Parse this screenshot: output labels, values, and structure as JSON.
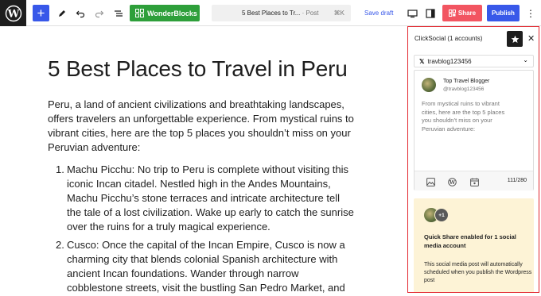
{
  "toolbar": {
    "wonderblocks_label": "WonderBlocks",
    "doc_title": "5 Best Places to Tr...",
    "doc_type": "· Post",
    "shortcut": "⌘K",
    "save_draft_label": "Save draft",
    "share_label": "Share",
    "publish_label": "Publish"
  },
  "post": {
    "title": "5 Best Places to Travel in Peru",
    "intro": "Peru, a land of ancient civilizations and breathtaking landscapes, offers travelers an unforgettable experience. From mystical ruins to vibrant cities, here are the top 5 places you shouldn’t miss on your Peruvian adventure:",
    "list": [
      {
        "num": "1.",
        "text": "Machu Picchu: No trip to Peru is complete without visiting this iconic Incan citadel. Nestled high in the Andes Mountains, Machu Picchu’s stone terraces and intricate architecture tell the tale of a lost civilization. Wake up early to catch the sunrise over the ruins for a truly magical experience."
      },
      {
        "num": "2.",
        "text": "Cusco: Once the capital of the Incan Empire, Cusco is now a charming city that blends colonial Spanish architecture with ancient Incan foundations. Wander through narrow cobblestone streets, visit the bustling San Pedro Market, and"
      }
    ]
  },
  "sidebar": {
    "title": "ClickSocial (1 accounts)",
    "account": "travblog123456",
    "user_name": "Top Travel Blogger",
    "user_handle": "@travblog123456",
    "post_text": "From mystical ruins to vibrant cities, here are the top 5 places you shouldn’t miss on your Peruvian adventure:",
    "counter": "111/280",
    "quick_badge": "+1",
    "quick_title": "Quick Share enabled for 1 social media account",
    "quick_text": "This social media post will automatically scheduled when you publish the Wordpress post"
  },
  "colors": {
    "accent": "#3858e9",
    "share": "#f25561",
    "wonderblocks": "#2e9f3a",
    "highlight_border": "#e2262e",
    "quick_bg": "#fdf3d6"
  },
  "icons": [
    "wordpress-icon",
    "plus-icon",
    "pen-icon",
    "undo-icon",
    "redo-icon",
    "list-view-icon",
    "wonderblocks-icon",
    "desktop-icon",
    "sidebar-icon",
    "share-icon",
    "more-icon",
    "star-icon",
    "close-icon",
    "x-logo-icon",
    "chevron-down-icon",
    "image-icon",
    "wordpress-link-icon",
    "schedule-icon"
  ]
}
